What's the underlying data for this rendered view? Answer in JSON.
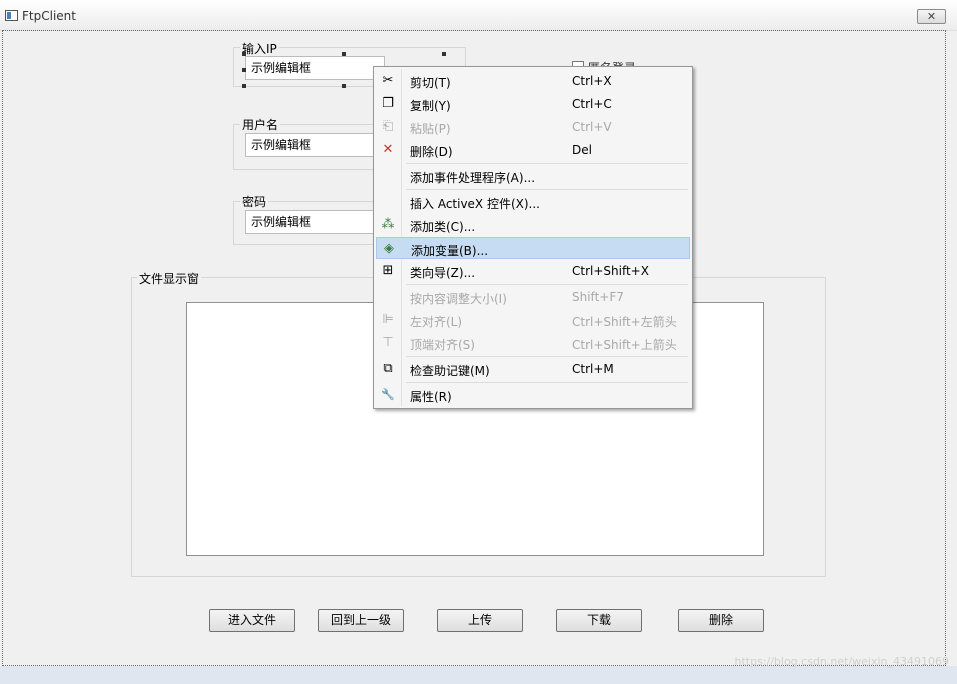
{
  "window": {
    "title": "FtpClient",
    "close_glyph": "✕"
  },
  "form": {
    "ip_label": "输入IP",
    "ip_value": "示例编辑框",
    "user_label": "用户名",
    "user_value": "示例编辑框",
    "password_label": "密码",
    "password_value": "示例编辑框",
    "checkbox_label": "匿名登录",
    "file_group_label": "文件显示窗"
  },
  "buttons": {
    "enter": "进入文件",
    "up": "回到上一级",
    "upload": "上传",
    "download": "下载",
    "delete": "删除"
  },
  "context_menu": {
    "items": [
      {
        "label": "剪切(T)",
        "shortcut": "Ctrl+X",
        "icon": "scissors-icon",
        "glyph": "✂"
      },
      {
        "label": "复制(Y)",
        "shortcut": "Ctrl+C",
        "icon": "copy-icon",
        "glyph": "❐"
      },
      {
        "label": "粘贴(P)",
        "shortcut": "Ctrl+V",
        "icon": "paste-icon",
        "glyph": "⎗"
      },
      {
        "label": "删除(D)",
        "shortcut": "Del",
        "icon": "delete-x-icon",
        "glyph": "✕"
      },
      {
        "label": "添加事件处理程序(A)...",
        "shortcut": ""
      },
      {
        "label": "插入 ActiveX 控件(X)...",
        "shortcut": ""
      },
      {
        "label": "添加类(C)...",
        "shortcut": "",
        "icon": "add-class-icon",
        "glyph": "⁂"
      },
      {
        "label": "添加变量(B)...",
        "shortcut": "",
        "icon": "add-variable-icon",
        "glyph": "◈"
      },
      {
        "label": "类向导(Z)...",
        "shortcut": "Ctrl+Shift+X",
        "icon": "class-wizard-icon",
        "glyph": "⊞"
      },
      {
        "label": "按内容调整大小(I)",
        "shortcut": "Shift+F7"
      },
      {
        "label": "左对齐(L)",
        "shortcut": "Ctrl+Shift+左箭头",
        "icon": "align-left-icon",
        "glyph": "⊫"
      },
      {
        "label": "顶端对齐(S)",
        "shortcut": "Ctrl+Shift+上箭头",
        "icon": "align-top-icon",
        "glyph": "⊤"
      },
      {
        "label": "检查助记键(M)",
        "shortcut": "Ctrl+M",
        "icon": "mnemonic-check-icon",
        "glyph": "⧉"
      },
      {
        "label": "属性(R)",
        "shortcut": "",
        "icon": "wrench-icon",
        "glyph": "🔧"
      }
    ]
  },
  "watermark": "https://blog.csdn.net/weixin_43491069",
  "colors": {
    "menu_highlight": "#c6dcf2",
    "delete_red": "#c0392b"
  }
}
